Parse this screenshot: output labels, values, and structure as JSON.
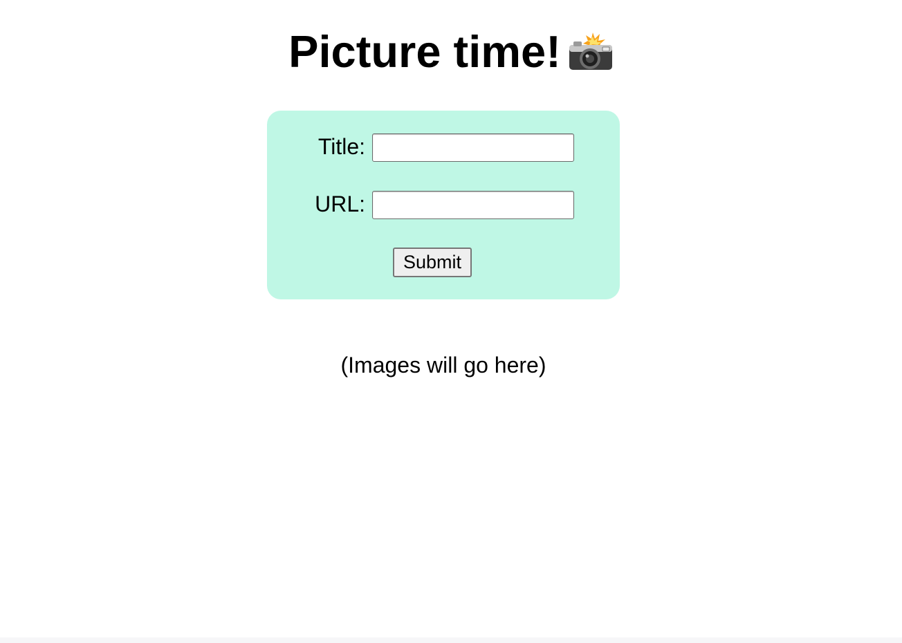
{
  "header": {
    "title": "Picture time!",
    "icon": "camera-with-flash-icon"
  },
  "form": {
    "background_color": "#bff7e5",
    "title_label": "Title:",
    "title_value": "",
    "url_label": "URL:",
    "url_value": "",
    "submit_label": "Submit"
  },
  "gallery": {
    "placeholder": "(Images will go here)"
  }
}
